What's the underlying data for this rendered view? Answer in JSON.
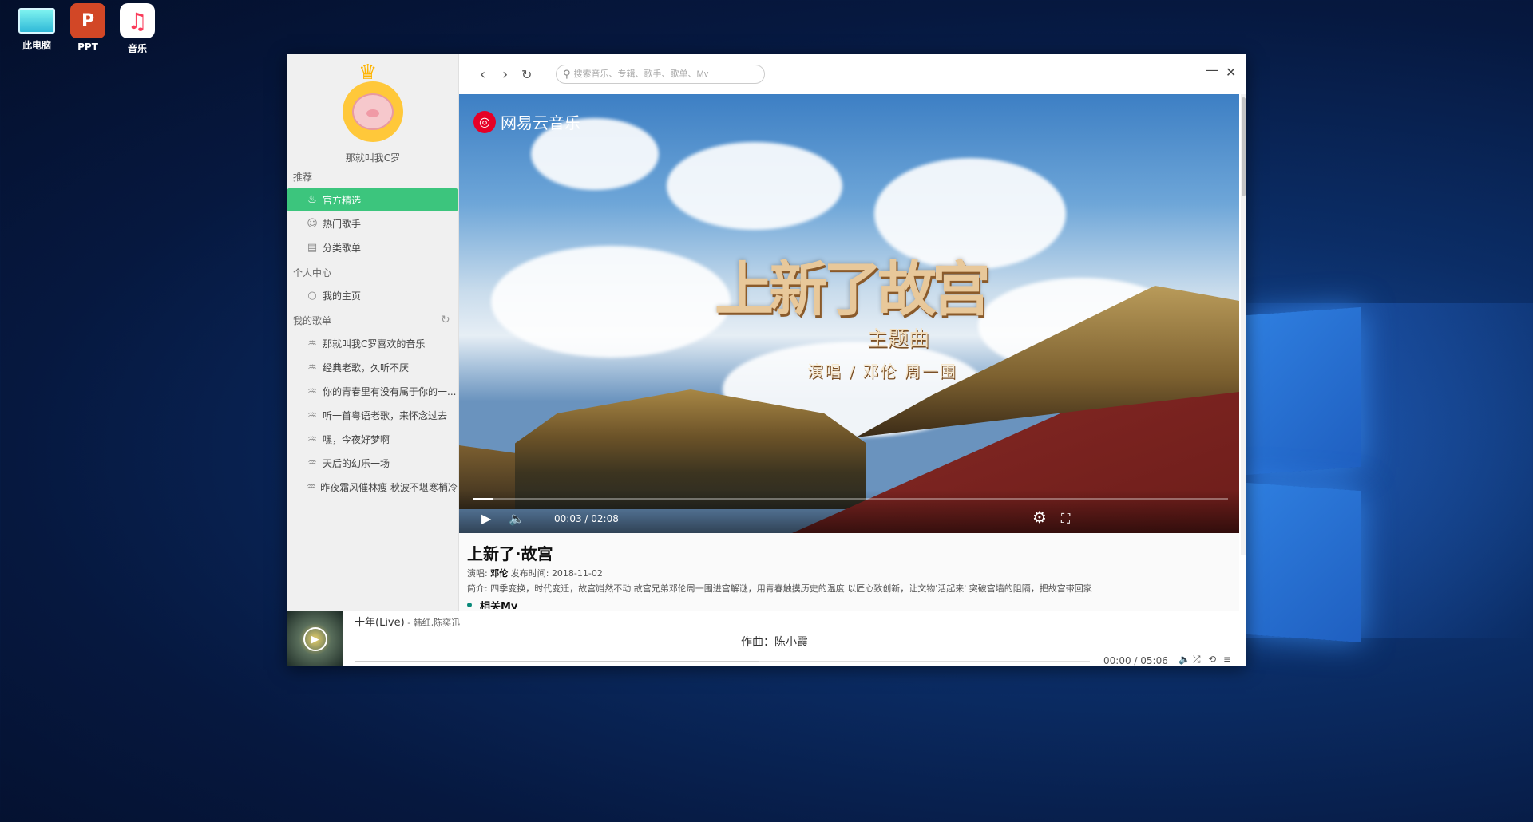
{
  "desktop": {
    "icons": [
      {
        "label": "此电脑"
      },
      {
        "label": "PPT"
      },
      {
        "label": "音乐"
      }
    ]
  },
  "sidebar": {
    "username": "那就叫我C罗",
    "sections": {
      "recommend": "推荐",
      "personal": "个人中心",
      "playlists": "我的歌单"
    },
    "recommend_items": [
      "官方精选",
      "热门歌手",
      "分类歌单"
    ],
    "personal_items": [
      "我的主页"
    ],
    "playlist_items": [
      "那就叫我C罗喜欢的音乐",
      "经典老歌，久听不厌",
      "你的青春里有没有属于你的一...",
      "听一首粤语老歌，来怀念过去",
      "嘿，今夜好梦啊",
      "天后的幻乐一场",
      "昨夜霜风催林瘦 秋波不堪寒梢冷"
    ]
  },
  "topbar": {
    "search_placeholder": "搜索音乐、专辑、歌手、歌单、Mv"
  },
  "video": {
    "brand": "网易云音乐",
    "title_art": "上新了故宫",
    "subtitle_art": "主题曲",
    "singers_art": "演唱 / 邓伦  周一围",
    "time": "00:03 / 02:08",
    "progress": 0.025
  },
  "info": {
    "title": "上新了·故宫",
    "singer_label": "演唱:",
    "singer": "邓伦",
    "release_label": "发布时间:",
    "release_date": "2018-11-02",
    "intro_label": "简介:",
    "intro": "四季变换，时代变迁，故宫岿然不动 故宫兄弟邓伦周一围进宫解谜，用青春触摸历史的温度 以匠心致创新，让文物'活起来' 突破宫墙的阻隔，把故宫带回家",
    "related": "相关Mv"
  },
  "player": {
    "song": "十年(Live)",
    "artist": " - 韩红,陈奕迅",
    "lyric": "作曲：陈小霞",
    "time": "00:00 / 05:06"
  }
}
